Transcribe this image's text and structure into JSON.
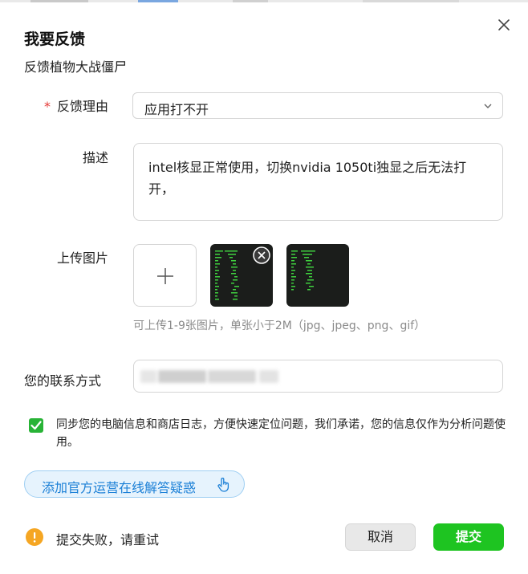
{
  "dialog": {
    "title": "我要反馈",
    "subtitle": "反馈植物大战僵尸"
  },
  "form": {
    "reason": {
      "required_mark": "*",
      "label": "反馈理由",
      "selected": "应用打不开"
    },
    "description": {
      "label": "描述",
      "value": "intel核显正常使用，切换nvidia 1050ti独显之后无法打开，"
    },
    "upload": {
      "label": "上传图片",
      "hint": "可上传1-9张图片，单张小于2M（jpg、jpeg、png、gif）",
      "image_count": 2
    },
    "contact": {
      "label": "您的联系方式",
      "value_obscured": true
    },
    "consent": {
      "checked": true,
      "text": "同步您的电脑信息和商店日志，方便快速定位问题，我们承诺，您的信息仅作为分析问题使用。"
    }
  },
  "support_button": {
    "label": "添加官方运营在线解答疑惑"
  },
  "status": {
    "error": "提交失败，请重试"
  },
  "actions": {
    "cancel": "取消",
    "submit": "提交"
  },
  "colors": {
    "accent_green": "#1ec421",
    "link_blue": "#1a7fd6",
    "required_red": "#e53935",
    "warning_orange": "#f5a623"
  }
}
